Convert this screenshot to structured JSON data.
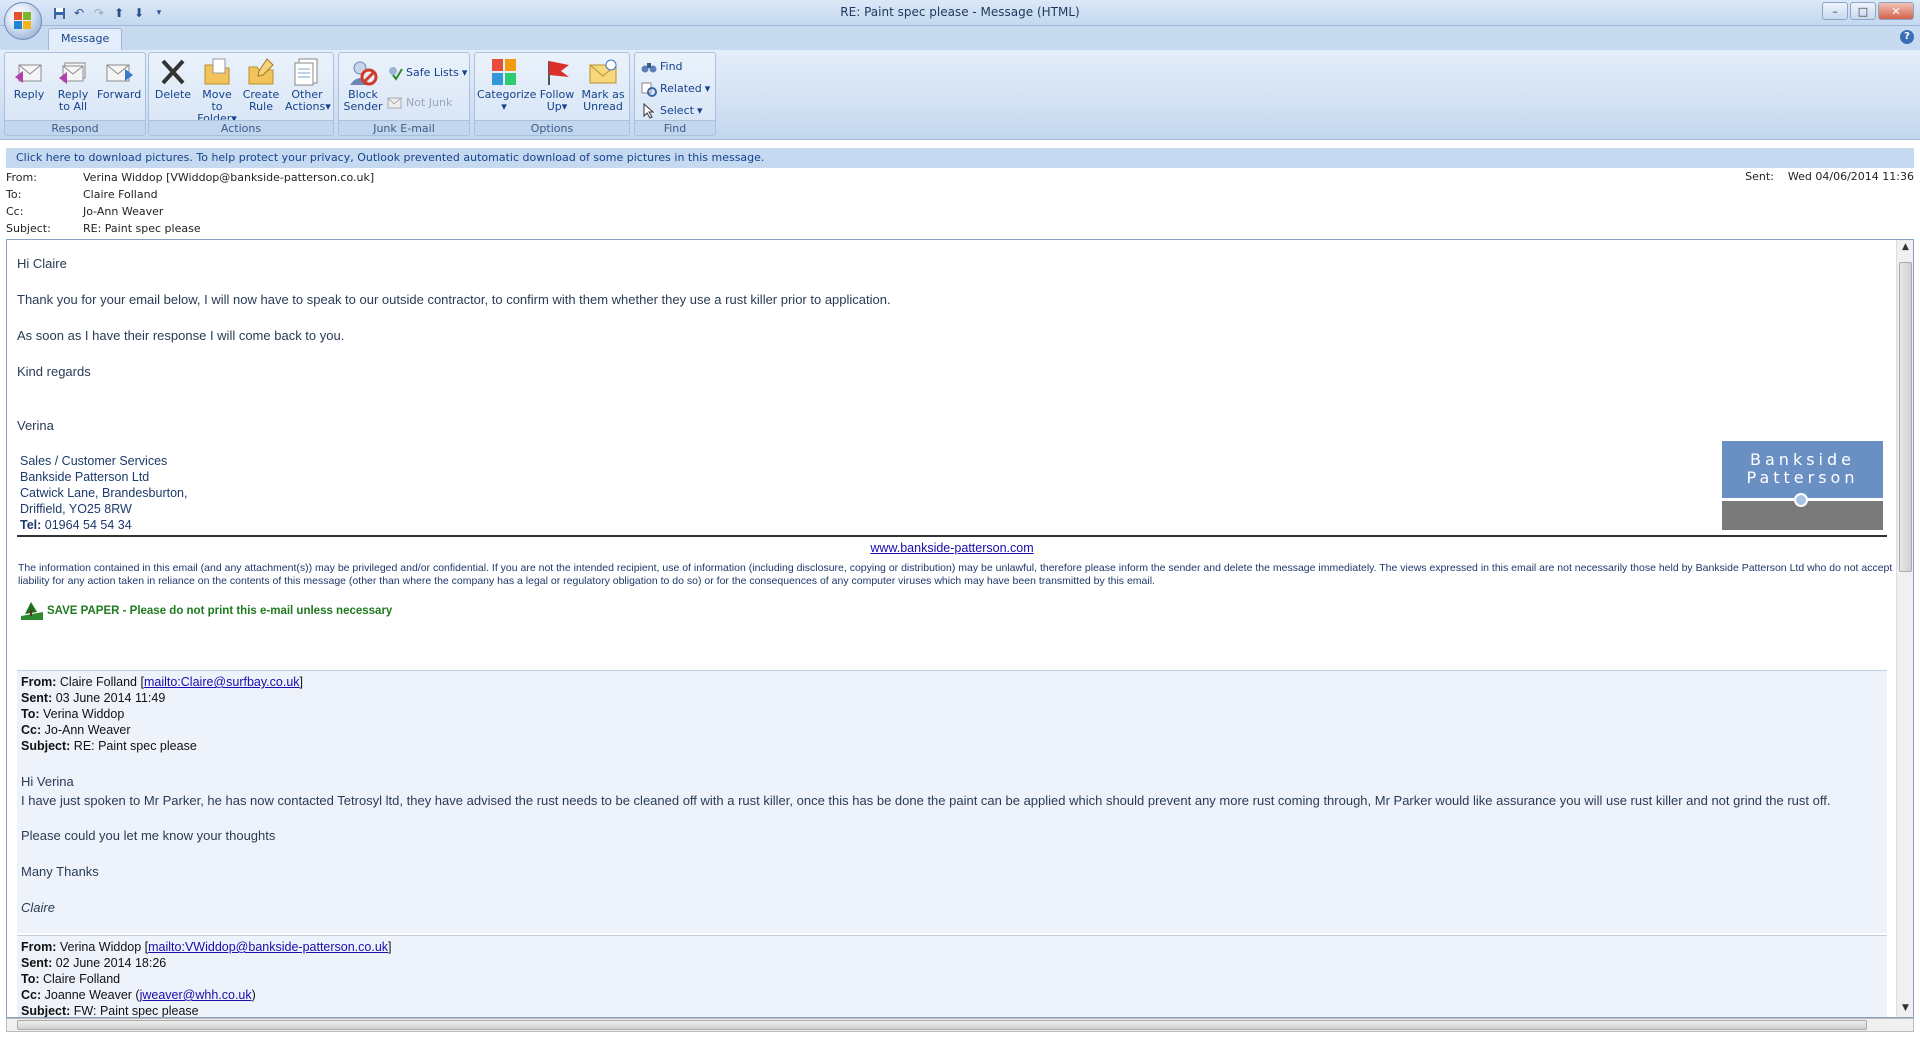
{
  "window": {
    "title": "RE: Paint spec please - Message (HTML)",
    "controls": [
      "–",
      "□",
      "✕"
    ]
  },
  "ribbon": {
    "tab": "Message",
    "help": "?",
    "groups": {
      "respond": {
        "label": "Respond",
        "reply": "Reply",
        "reply_all_1": "Reply",
        "reply_all_2": "to All",
        "forward": "Forward"
      },
      "actions": {
        "label": "Actions",
        "delete": "Delete",
        "move_1": "Move to",
        "move_2": "Folder",
        "create_1": "Create",
        "create_2": "Rule",
        "other_1": "Other",
        "other_2": "Actions"
      },
      "junk": {
        "label": "Junk E-mail",
        "block_1": "Block",
        "block_2": "Sender",
        "safe_lists": "Safe Lists",
        "not_junk": "Not Junk"
      },
      "options": {
        "label": "Options",
        "categorize": "Categorize",
        "follow_1": "Follow",
        "follow_2": "Up",
        "mark_1": "Mark as",
        "mark_2": "Unread"
      },
      "find": {
        "label": "Find",
        "find": "Find",
        "related": "Related",
        "select": "Select"
      }
    }
  },
  "infobar": "Click here to download pictures. To help protect your privacy, Outlook prevented automatic download of some pictures in this message.",
  "header": {
    "from_label": "From:",
    "from": "Verina Widdop [VWiddop@bankside-patterson.co.uk]",
    "to_label": "To:",
    "to": "Claire Folland",
    "cc_label": "Cc:",
    "cc": "Jo-Ann Weaver",
    "subject_label": "Subject:",
    "subject": "RE: Paint spec please",
    "sent_label": "Sent:",
    "sent": "Wed 04/06/2014 11:36"
  },
  "body": {
    "greeting": "Hi Claire",
    "p1": "Thank you for your email below, I will now have to speak to our outside contractor, to confirm with them whether they use a rust killer prior to application.",
    "p2": "As soon as I have their response I will come back to you.",
    "regards": "Kind regards",
    "name": "Verina",
    "sig1": "Sales / Customer Services",
    "sig2": "Bankside Patterson Ltd",
    "sig3": "Catwick Lane, Brandesburton,",
    "sig4": "Driffield, YO25 8RW",
    "tel_label": "Tel:",
    "tel": " 01964 54 54 34",
    "logo_1": "Bankside",
    "logo_2": "Patterson",
    "website": "www.bankside-patterson.com",
    "disclaimer": "The information contained in this email (and any attachment(s)) may be privileged and/or confidential. If you are not the intended recipient, use of information (including disclosure, copying or distribution) may be unlawful, therefore please inform the sender and delete the message immediately. The views expressed in this email are not necessarily those held by Bankside Patterson Ltd who do not accept liability for any action taken in reliance on the contents of this message (other than where the company has a legal or regulatory obligation to do so) or for the consequences of any computer viruses which may have been transmitted by this email.",
    "save_paper": "SAVE PAPER - Please do not print this e-mail unless necessary"
  },
  "quote1": {
    "from_label": "From:",
    "from_name": " Claire Folland [",
    "from_link": "mailto:Claire@surfbay.co.uk",
    "from_end": "]",
    "sent_label": "Sent:",
    "sent": " 03 June 2014 11:49",
    "to_label": "To:",
    "to": " Verina Widdop",
    "cc_label": "Cc:",
    "cc": " Jo-Ann Weaver",
    "subject_label": "Subject:",
    "subject": " RE: Paint spec please",
    "greeting": "Hi Verina",
    "p1": "I have just spoken to Mr Parker, he has now contacted Tetrosyl ltd, they have advised the rust needs to be cleaned off with a rust killer, once this has be done the paint can be applied which should prevent any more rust coming through, Mr Parker would like assurance you will use rust killer and not grind the rust off.",
    "p2": "Please could you let me know your thoughts",
    "thanks": "Many Thanks",
    "name": "Claire"
  },
  "quote2": {
    "from_label": "From:",
    "from_name": " Verina Widdop [",
    "from_link": "mailto:VWiddop@bankside-patterson.co.uk",
    "from_end": "]",
    "sent_label": "Sent:",
    "sent": " 02 June 2014 18:26",
    "to_label": "To:",
    "to": " Claire Folland",
    "cc_label": "Cc:",
    "cc": " Joanne Weaver (",
    "cc_link": "jweaver@whh.co.uk",
    "cc_end": ")",
    "subject_label": "Subject:",
    "subject": " FW: Paint spec please"
  }
}
